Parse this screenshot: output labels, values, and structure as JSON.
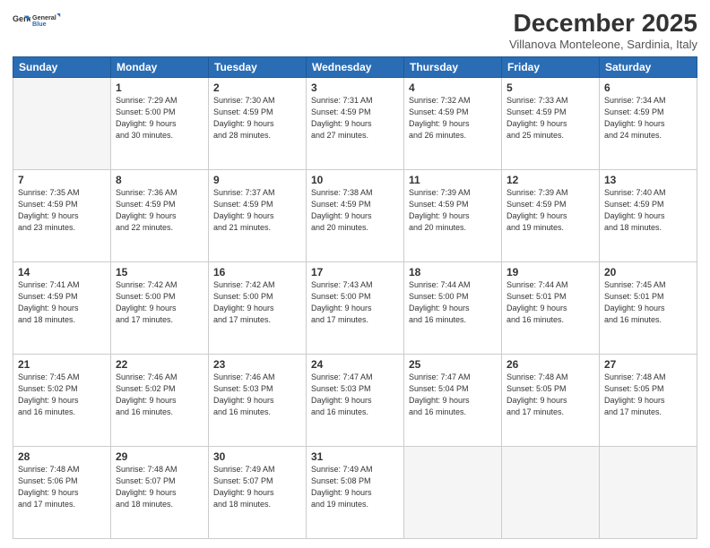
{
  "logo": {
    "line1": "General",
    "line2": "Blue"
  },
  "title": "December 2025",
  "location": "Villanova Monteleone, Sardinia, Italy",
  "days_of_week": [
    "Sunday",
    "Monday",
    "Tuesday",
    "Wednesday",
    "Thursday",
    "Friday",
    "Saturday"
  ],
  "weeks": [
    [
      {
        "day": "",
        "info": ""
      },
      {
        "day": "1",
        "info": "Sunrise: 7:29 AM\nSunset: 5:00 PM\nDaylight: 9 hours\nand 30 minutes."
      },
      {
        "day": "2",
        "info": "Sunrise: 7:30 AM\nSunset: 4:59 PM\nDaylight: 9 hours\nand 28 minutes."
      },
      {
        "day": "3",
        "info": "Sunrise: 7:31 AM\nSunset: 4:59 PM\nDaylight: 9 hours\nand 27 minutes."
      },
      {
        "day": "4",
        "info": "Sunrise: 7:32 AM\nSunset: 4:59 PM\nDaylight: 9 hours\nand 26 minutes."
      },
      {
        "day": "5",
        "info": "Sunrise: 7:33 AM\nSunset: 4:59 PM\nDaylight: 9 hours\nand 25 minutes."
      },
      {
        "day": "6",
        "info": "Sunrise: 7:34 AM\nSunset: 4:59 PM\nDaylight: 9 hours\nand 24 minutes."
      }
    ],
    [
      {
        "day": "7",
        "info": "Sunrise: 7:35 AM\nSunset: 4:59 PM\nDaylight: 9 hours\nand 23 minutes."
      },
      {
        "day": "8",
        "info": "Sunrise: 7:36 AM\nSunset: 4:59 PM\nDaylight: 9 hours\nand 22 minutes."
      },
      {
        "day": "9",
        "info": "Sunrise: 7:37 AM\nSunset: 4:59 PM\nDaylight: 9 hours\nand 21 minutes."
      },
      {
        "day": "10",
        "info": "Sunrise: 7:38 AM\nSunset: 4:59 PM\nDaylight: 9 hours\nand 20 minutes."
      },
      {
        "day": "11",
        "info": "Sunrise: 7:39 AM\nSunset: 4:59 PM\nDaylight: 9 hours\nand 20 minutes."
      },
      {
        "day": "12",
        "info": "Sunrise: 7:39 AM\nSunset: 4:59 PM\nDaylight: 9 hours\nand 19 minutes."
      },
      {
        "day": "13",
        "info": "Sunrise: 7:40 AM\nSunset: 4:59 PM\nDaylight: 9 hours\nand 18 minutes."
      }
    ],
    [
      {
        "day": "14",
        "info": "Sunrise: 7:41 AM\nSunset: 4:59 PM\nDaylight: 9 hours\nand 18 minutes."
      },
      {
        "day": "15",
        "info": "Sunrise: 7:42 AM\nSunset: 5:00 PM\nDaylight: 9 hours\nand 17 minutes."
      },
      {
        "day": "16",
        "info": "Sunrise: 7:42 AM\nSunset: 5:00 PM\nDaylight: 9 hours\nand 17 minutes."
      },
      {
        "day": "17",
        "info": "Sunrise: 7:43 AM\nSunset: 5:00 PM\nDaylight: 9 hours\nand 17 minutes."
      },
      {
        "day": "18",
        "info": "Sunrise: 7:44 AM\nSunset: 5:00 PM\nDaylight: 9 hours\nand 16 minutes."
      },
      {
        "day": "19",
        "info": "Sunrise: 7:44 AM\nSunset: 5:01 PM\nDaylight: 9 hours\nand 16 minutes."
      },
      {
        "day": "20",
        "info": "Sunrise: 7:45 AM\nSunset: 5:01 PM\nDaylight: 9 hours\nand 16 minutes."
      }
    ],
    [
      {
        "day": "21",
        "info": "Sunrise: 7:45 AM\nSunset: 5:02 PM\nDaylight: 9 hours\nand 16 minutes."
      },
      {
        "day": "22",
        "info": "Sunrise: 7:46 AM\nSunset: 5:02 PM\nDaylight: 9 hours\nand 16 minutes."
      },
      {
        "day": "23",
        "info": "Sunrise: 7:46 AM\nSunset: 5:03 PM\nDaylight: 9 hours\nand 16 minutes."
      },
      {
        "day": "24",
        "info": "Sunrise: 7:47 AM\nSunset: 5:03 PM\nDaylight: 9 hours\nand 16 minutes."
      },
      {
        "day": "25",
        "info": "Sunrise: 7:47 AM\nSunset: 5:04 PM\nDaylight: 9 hours\nand 16 minutes."
      },
      {
        "day": "26",
        "info": "Sunrise: 7:48 AM\nSunset: 5:05 PM\nDaylight: 9 hours\nand 17 minutes."
      },
      {
        "day": "27",
        "info": "Sunrise: 7:48 AM\nSunset: 5:05 PM\nDaylight: 9 hours\nand 17 minutes."
      }
    ],
    [
      {
        "day": "28",
        "info": "Sunrise: 7:48 AM\nSunset: 5:06 PM\nDaylight: 9 hours\nand 17 minutes."
      },
      {
        "day": "29",
        "info": "Sunrise: 7:48 AM\nSunset: 5:07 PM\nDaylight: 9 hours\nand 18 minutes."
      },
      {
        "day": "30",
        "info": "Sunrise: 7:49 AM\nSunset: 5:07 PM\nDaylight: 9 hours\nand 18 minutes."
      },
      {
        "day": "31",
        "info": "Sunrise: 7:49 AM\nSunset: 5:08 PM\nDaylight: 9 hours\nand 19 minutes."
      },
      {
        "day": "",
        "info": ""
      },
      {
        "day": "",
        "info": ""
      },
      {
        "day": "",
        "info": ""
      }
    ]
  ]
}
